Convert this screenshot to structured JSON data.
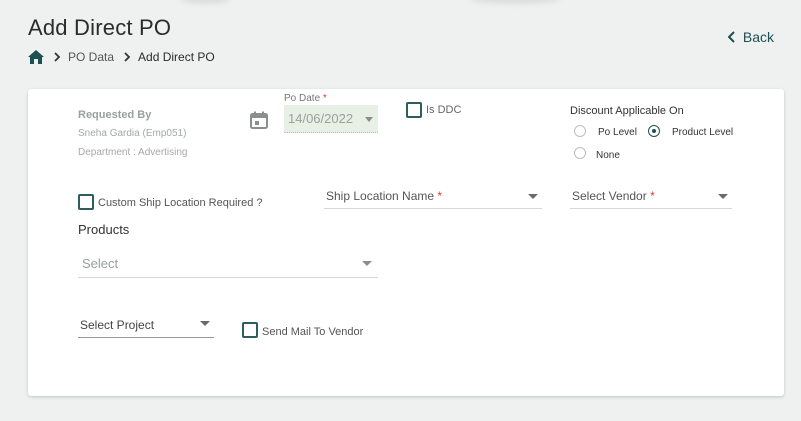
{
  "header": {
    "title": "Add Direct PO",
    "back_label": "Back"
  },
  "breadcrumb": {
    "items": [
      "PO Data",
      "Add Direct PO"
    ]
  },
  "form": {
    "requested_by": {
      "label": "Requested By",
      "name": "Sneha Gardia (Emp051)",
      "department": "Department : Advertising"
    },
    "po_date": {
      "label": "Po Date",
      "required_mark": "*",
      "value": "14/06/2022"
    },
    "is_ddc": {
      "label": "Is DDC",
      "checked": false
    },
    "discount": {
      "label": "Discount Applicable On",
      "options": [
        "Po Level",
        "Product Level",
        "None"
      ],
      "selected": "Product Level"
    },
    "custom_ship": {
      "label": "Custom Ship Location Required ?",
      "checked": false
    },
    "ship_location": {
      "label": "Ship Location Name",
      "required_mark": "*"
    },
    "vendor": {
      "label": "Select Vendor",
      "required_mark": "*"
    },
    "products": {
      "title": "Products",
      "placeholder": "Select"
    },
    "project": {
      "label": "Select Project"
    },
    "send_mail": {
      "label": "Send Mail To Vendor",
      "checked": false
    }
  },
  "colors": {
    "accent": "#1e4f52",
    "required": "#e53935",
    "background": "#eef1f0",
    "card": "#ffffff",
    "disabled_field": "#e8efe4"
  },
  "icons": {
    "home": "home-icon",
    "breadcrumb_sep": "chevron-right-icon",
    "back": "chevron-left-icon",
    "calendar": "calendar-icon",
    "dropdown": "caret-down-icon"
  }
}
